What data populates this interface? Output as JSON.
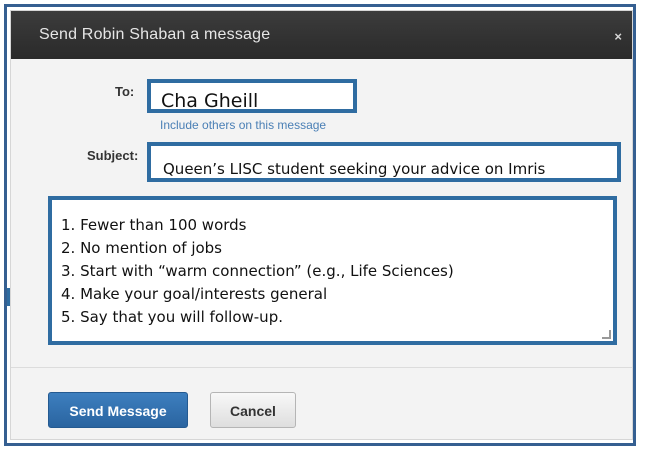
{
  "dialog": {
    "title": "Send Robin Shaban a message",
    "close_glyph": "×"
  },
  "form": {
    "to_label": "To:",
    "to_value": "Cha Gheill",
    "include_link": "Include others on this message",
    "subject_label": "Subject:",
    "subject_value": "Queen’s LISC student seeking your advice on Imris",
    "body_lines": [
      "1. Fewer than 100 words",
      "2. No mention of jobs",
      "3. Start with “warm connection” (e.g., Life Sciences)",
      "4. Make your goal/interests general",
      "5. Say that you will follow-up."
    ]
  },
  "buttons": {
    "send_label": "Send Message",
    "cancel_label": "Cancel"
  },
  "colors": {
    "highlight_border": "#2f6ca1",
    "primary_button": "#2a64a0",
    "title_bar": "#2f2f2f"
  }
}
